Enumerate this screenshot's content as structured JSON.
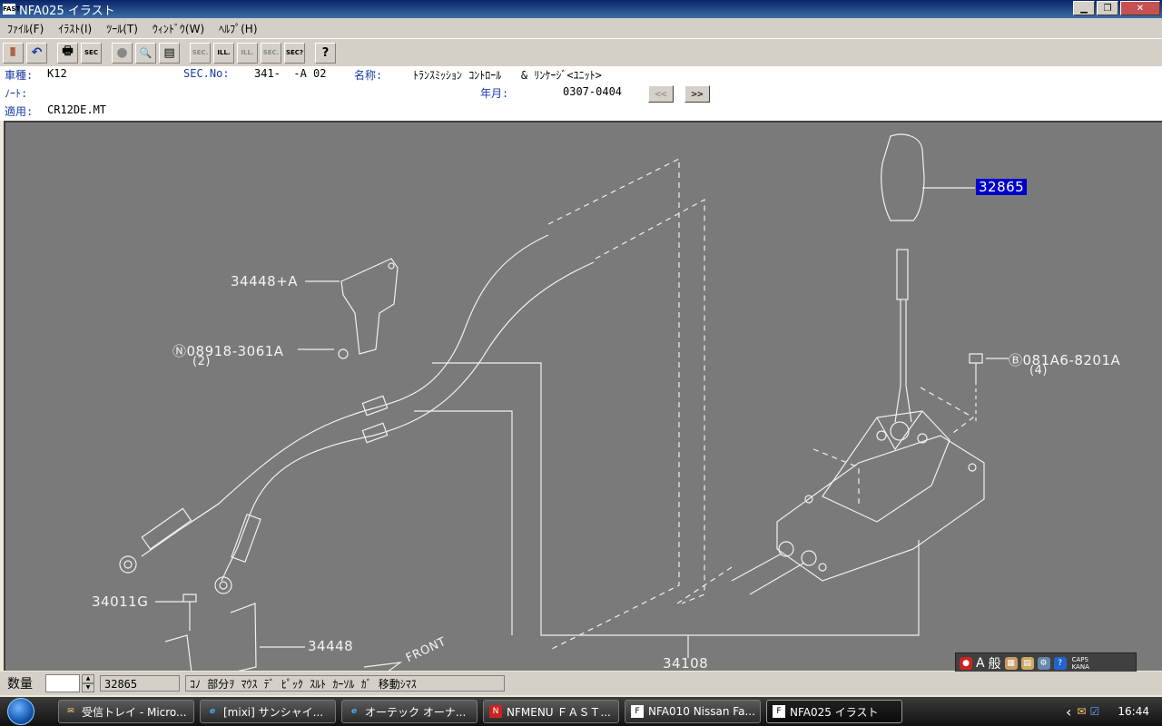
{
  "window": {
    "icon_text": "FAST",
    "title": "NFA025 イラスト",
    "minimize": "▁",
    "maximize": "❐",
    "close": "✕"
  },
  "menubar": {
    "items": [
      "ﾌｧｲﾙ(F)",
      "ｲﾗｽﾄ(I)",
      "ﾂｰﾙ(T)",
      "ｳｨﾝﾄﾞｳ(W)",
      "ﾍﾙﾌﾟ(H)"
    ]
  },
  "toolbar": {
    "buttons": [
      {
        "name": "exit-icon",
        "glyph": "🚪"
      },
      {
        "name": "undo-icon",
        "glyph": "↶"
      },
      {
        "name": "print-icon",
        "glyph": "🖶"
      },
      {
        "name": "sec-icon",
        "glyph": "SEC"
      },
      {
        "name": "circle-icon",
        "glyph": "●"
      },
      {
        "name": "zoom-icon",
        "glyph": "🔍"
      },
      {
        "name": "list-icon",
        "glyph": "▤"
      },
      {
        "name": "sec-prev-icon",
        "glyph": "SEC."
      },
      {
        "name": "ill-icon",
        "glyph": "ILL."
      },
      {
        "name": "ill-next-icon",
        "glyph": "ILL."
      },
      {
        "name": "sec-next-icon",
        "glyph": "SEC."
      },
      {
        "name": "sec-query-icon",
        "glyph": "SEC?"
      },
      {
        "name": "help-icon",
        "glyph": "?"
      }
    ]
  },
  "info": {
    "model_label": "車種:",
    "model_value": "K12",
    "sec_label": "SEC.No:",
    "sec_value": "341-  -A 02",
    "name_label": "名称:",
    "name_value": "ﾄﾗﾝｽﾐｯｼｮﾝ ｺﾝﾄﾛｰﾙ   & ﾘﾝｹｰｼﾞ<ﾕﾆｯﾄ>",
    "note_label": "ﾉｰﾄ:",
    "date_label": "年月:",
    "date_value": "0307-0404",
    "prev_button": "<<",
    "next_button": ">>",
    "apply_label": "適用:",
    "apply_value": "CR12DE.MT"
  },
  "illustration": {
    "callouts": [
      {
        "id": "c1",
        "text": "32865",
        "selected": true
      },
      {
        "id": "c2",
        "text": "34448+A"
      },
      {
        "id": "c3",
        "text": "Ⓝ08918-3061A"
      },
      {
        "id": "c3q",
        "text": "(2)"
      },
      {
        "id": "c4",
        "text": "Ⓑ081A6-8201A"
      },
      {
        "id": "c4q",
        "text": "(4)"
      },
      {
        "id": "c5",
        "text": "34011G"
      },
      {
        "id": "c6",
        "text": "34448"
      },
      {
        "id": "c7",
        "text": "34108"
      },
      {
        "id": "c8",
        "text": "FRONT"
      }
    ]
  },
  "statusbar": {
    "qty_label": "数量",
    "part_no": "32865",
    "message": "ｺﾉ 部分ｦ ﾏｳｽ ﾃﾞ ﾋﾟｯｸ ｽﾙﾄ ｶｰｿﾙ ｶﾞ 移動ｼﾏｽ"
  },
  "ime": {
    "mode": "A",
    "style": "般",
    "caps": "CAPS",
    "kana": "KANA"
  },
  "taskbar": {
    "tasks": [
      {
        "icon": "✉",
        "label": "受信トレイ - Micro...",
        "active": false
      },
      {
        "icon": "e",
        "label": "[mixi] サンシャイ...",
        "active": false
      },
      {
        "icon": "e",
        "label": "オーテック オーナ...",
        "active": false
      },
      {
        "icon": "N",
        "label": "NFMENU ＦＡＳＴ...",
        "active": false
      },
      {
        "icon": "F",
        "label": "NFA010 Nissan Fa...",
        "active": false
      },
      {
        "icon": "F",
        "label": "NFA025 イラスト",
        "active": true
      }
    ],
    "tray_arrow": "‹",
    "clock": "16:44"
  }
}
